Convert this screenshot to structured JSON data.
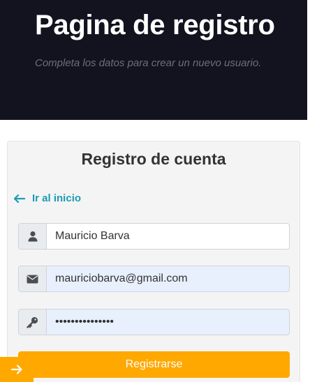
{
  "header": {
    "title": "Pagina de registro",
    "subtitle": "Completa los datos para crear un nuevo usuario."
  },
  "form": {
    "title": "Registro de cuenta",
    "back_link": "Ir al inicio",
    "name_value": "Mauricio Barva",
    "email_value": "mauriciobarva@gmail.com",
    "password_value": "passwordexample",
    "submit_label": "Registrarse"
  },
  "icons": {
    "back": "arrow-left-icon",
    "name": "user-icon",
    "email": "envelope-icon",
    "password": "key-icon",
    "corner": "arrow-right-icon"
  },
  "colors": {
    "hero_bg": "#12131f",
    "accent": "#1a9bb5",
    "button": "#ffa800",
    "autofill": "#e8f0fe"
  }
}
